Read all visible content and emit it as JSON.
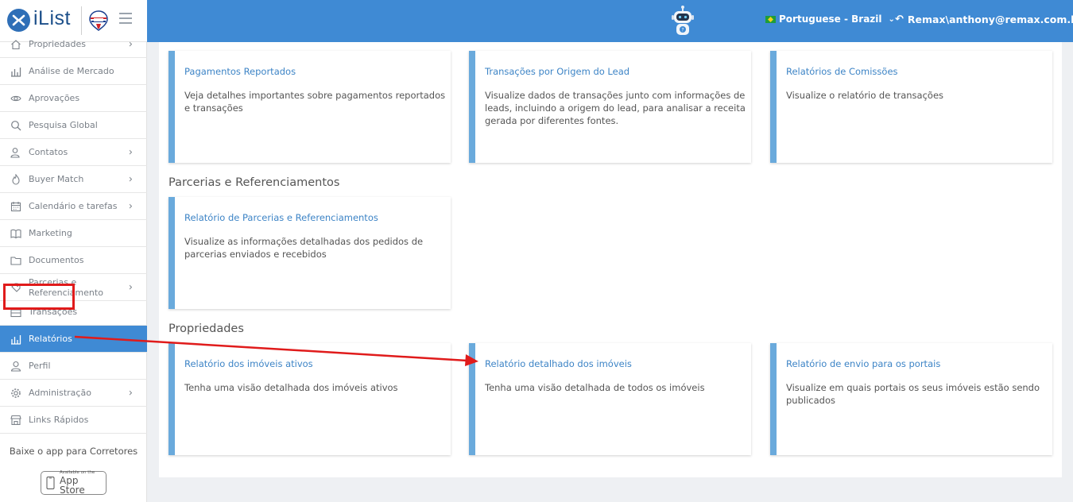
{
  "brand": {
    "name": "iList"
  },
  "header": {
    "language": "Portuguese - Brazil",
    "user": "Remax\\anthony@remax.com.br"
  },
  "sidebar": {
    "items": [
      {
        "label": "Propriedades",
        "icon": "home-icon",
        "chevron": true
      },
      {
        "label": "Análise de Mercado",
        "icon": "bar-chart-icon",
        "chevron": false
      },
      {
        "label": "Aprovações",
        "icon": "eye-icon",
        "chevron": false
      },
      {
        "label": "Pesquisa Global",
        "icon": "search-icon",
        "chevron": false
      },
      {
        "label": "Contatos",
        "icon": "contacts-icon",
        "chevron": true
      },
      {
        "label": "Buyer Match",
        "icon": "fire-icon",
        "chevron": true
      },
      {
        "label": "Calendário e tarefas",
        "icon": "calendar-icon",
        "chevron": true
      },
      {
        "label": "Marketing",
        "icon": "newspaper-icon",
        "chevron": false
      },
      {
        "label": "Documentos",
        "icon": "folder-icon",
        "chevron": false
      },
      {
        "label": "Parcerias e Referenciamento",
        "label_line1": "Parcerias e",
        "label_line2": "Referenciamento",
        "icon": "handshake-icon",
        "chevron": true
      },
      {
        "label": "Transações",
        "icon": "briefcase-icon",
        "chevron": false
      },
      {
        "label": "Relatórios",
        "icon": "reports-icon",
        "chevron": false,
        "active": true
      },
      {
        "label": "Perfil",
        "icon": "user-icon",
        "chevron": false
      },
      {
        "label": "Administração",
        "icon": "gear-icon",
        "chevron": true
      },
      {
        "label": "Links Rápidos",
        "icon": "store-icon",
        "chevron": false
      }
    ],
    "app_title": "Baixe o app para Corretores",
    "appstore_small": "Available on the",
    "appstore_big": "App Store"
  },
  "sections": [
    {
      "title": "",
      "cards": [
        {
          "title": "Pagamentos Reportados",
          "desc": "Veja detalhes importantes sobre pagamentos reportados e transações"
        },
        {
          "title": "Transações por Origem do Lead",
          "desc": "Visualize dados de transações junto com informações de leads, incluindo a origem do lead, para analisar a receita gerada por diferentes fontes."
        },
        {
          "title": "Relatórios de Comissões",
          "desc": "Visualize o relatório de transações"
        }
      ]
    },
    {
      "title": "Parcerias e Referenciamentos",
      "cards": [
        {
          "title": "Relatório de Parcerias e Referenciamentos",
          "desc": "Visualize as informações detalhadas dos pedidos de parcerias enviados e recebidos"
        }
      ]
    },
    {
      "title": "Propriedades",
      "cards": [
        {
          "title": "Relatório dos imóveis ativos",
          "desc": "Tenha uma visão detalhada dos imóveis ativos"
        },
        {
          "title": "Relatório detalhado dos imóveis",
          "desc": "Tenha uma visão detalhada de todos os imóveis"
        },
        {
          "title": "Relatório de envio para os portais",
          "desc": "Visualize em quais portais os seus imóveis estão sendo publicados"
        }
      ]
    }
  ],
  "colors": {
    "accent": "#3f8ad4",
    "card_border": "#6aaadc",
    "highlight": "#e01b1b"
  }
}
